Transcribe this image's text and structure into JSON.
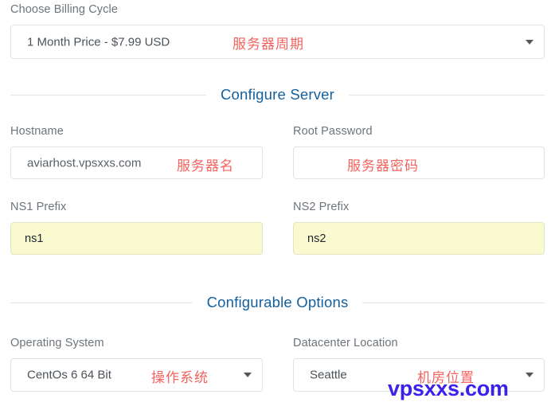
{
  "colors": {
    "section_heading": "#15609c",
    "annotation_red": "#f2635f",
    "watermark_blue": "#3b21ea",
    "label_gray": "#6d747b",
    "autofill_yellow": "#fafad0",
    "border_gray": "#dfe3e6"
  },
  "billing": {
    "label": "Choose Billing Cycle",
    "selected": "1 Month Price - $7.99 USD",
    "annotation": "服务器周期",
    "caret_icon": "chevron-down-icon"
  },
  "sections": {
    "configure_server": "Configure Server",
    "configurable_options": "Configurable Options"
  },
  "hostname": {
    "label": "Hostname",
    "value": "aviarhost.vpsxxs.com",
    "annotation": "服务器名"
  },
  "root_password": {
    "label": "Root Password",
    "value": "",
    "annotation": "服务器密码"
  },
  "ns1": {
    "label": "NS1 Prefix",
    "value": "ns1"
  },
  "ns2": {
    "label": "NS2 Prefix",
    "value": "ns2"
  },
  "operating_system": {
    "label": "Operating System",
    "selected": "CentOs 6 64 Bit",
    "annotation": "操作系统",
    "caret_icon": "chevron-down-icon"
  },
  "datacenter_location": {
    "label": "Datacenter Location",
    "selected": "Seattle",
    "annotation": "机房位置",
    "caret_icon": "chevron-down-icon"
  },
  "watermark": {
    "text": "vpsxxs.com"
  }
}
